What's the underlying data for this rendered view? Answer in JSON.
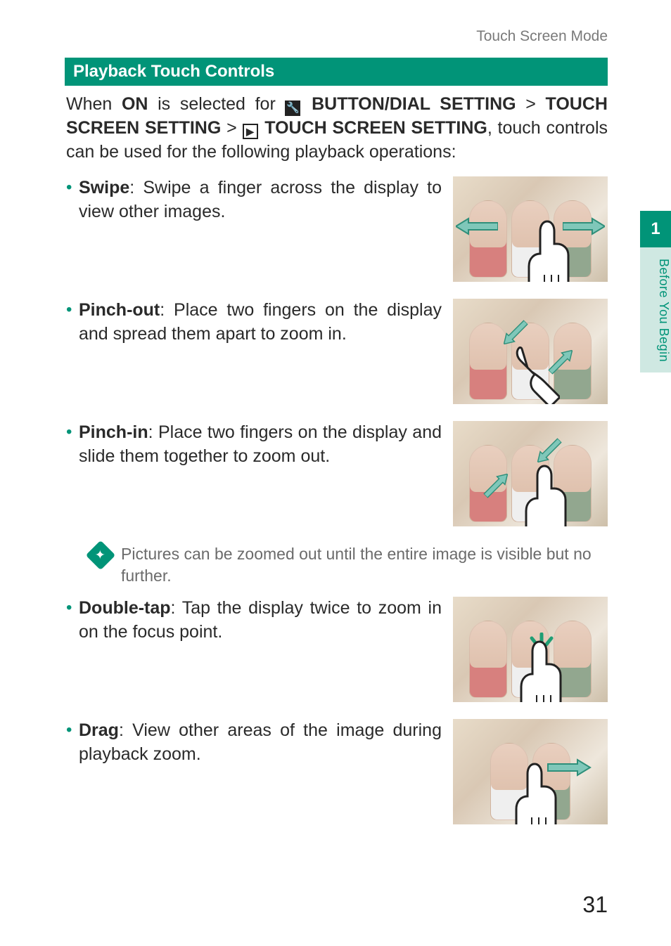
{
  "header": {
    "section": "Touch Screen Mode"
  },
  "section_bar": "Playback Touch Controls",
  "intro": {
    "prefix": "When ",
    "on": "ON",
    "mid": " is selected for ",
    "path1": "BUTTON/DIAL SETTING",
    "gt": ">",
    "path2": "TOUCH SCREEN SETTING",
    "path3": "TOUCH SCREEN SETTING",
    "after": ", touch controls can be used for the following playback operations:"
  },
  "items": [
    {
      "term": "Swipe",
      "desc": ": Swipe a finger across the display to view other images."
    },
    {
      "term": "Pinch-out",
      "desc": ": Place two fingers on the display and spread them apart to zoom in."
    },
    {
      "term": "Pinch-in",
      "desc": ": Place two fingers on the display and slide them together to zoom out."
    }
  ],
  "note": "Pictures can be zoomed out until the entire image is visible but no further.",
  "items2": [
    {
      "term": "Double-tap",
      "desc": ": Tap the display twice to zoom in on the focus point."
    },
    {
      "term": "Drag",
      "desc": ": View other areas of the image during playback zoom."
    }
  ],
  "sidebar": {
    "chapter_num": "1",
    "chapter_label": "Before You Begin"
  },
  "page_number": "31"
}
